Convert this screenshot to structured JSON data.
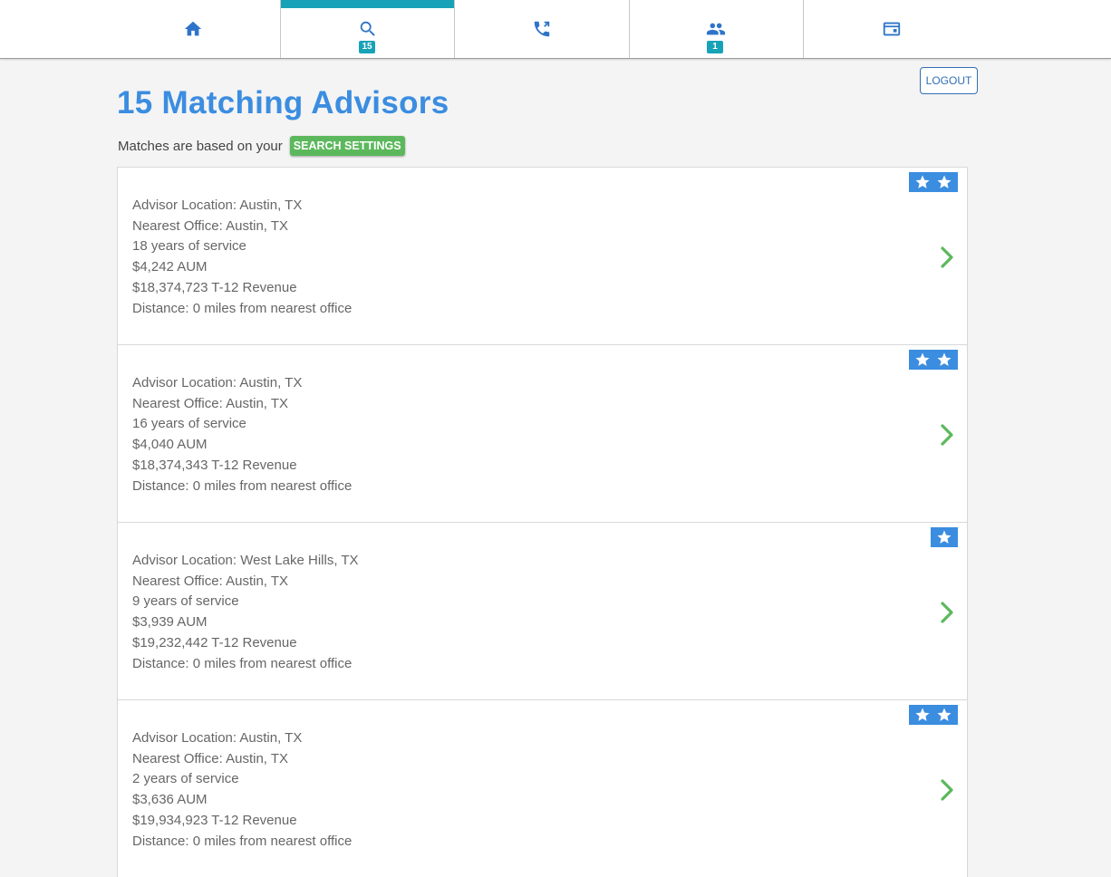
{
  "nav": {
    "tabs": [
      {
        "name": "home",
        "icon": "home-icon",
        "badge": null,
        "active": false
      },
      {
        "name": "search",
        "icon": "search-icon",
        "badge": "15",
        "active": true
      },
      {
        "name": "calls",
        "icon": "phone-icon",
        "badge": null,
        "active": false
      },
      {
        "name": "people",
        "icon": "people-icon",
        "badge": "1",
        "active": false
      },
      {
        "name": "profile",
        "icon": "card-icon",
        "badge": null,
        "active": false
      }
    ]
  },
  "header": {
    "logout_label": "LOGOUT",
    "title": "15 Matching Advisors",
    "subtitle": "Matches are based on your",
    "settings_label": "SEARCH SETTINGS"
  },
  "colors": {
    "brand_blue": "#3b8de0",
    "teal": "#17a2b8",
    "green": "#5cb85c"
  },
  "advisors": [
    {
      "location": "Advisor Location: Austin, TX",
      "office": "Nearest Office: Austin, TX",
      "service": "18 years of service",
      "aum": "$4,242 AUM",
      "revenue": "$18,374,723 T-12 Revenue",
      "distance": "Distance: 0 miles from nearest office",
      "stars": 2
    },
    {
      "location": "Advisor Location: Austin, TX",
      "office": "Nearest Office: Austin, TX",
      "service": "16 years of service",
      "aum": "$4,040 AUM",
      "revenue": "$18,374,343 T-12 Revenue",
      "distance": "Distance: 0 miles from nearest office",
      "stars": 2
    },
    {
      "location": "Advisor Location: West Lake Hills, TX",
      "office": "Nearest Office: Austin, TX",
      "service": "9 years of service",
      "aum": "$3,939 AUM",
      "revenue": "$19,232,442 T-12 Revenue",
      "distance": "Distance: 0 miles from nearest office",
      "stars": 1
    },
    {
      "location": "Advisor Location: Austin, TX",
      "office": "Nearest Office: Austin, TX",
      "service": "2 years of service",
      "aum": "$3,636 AUM",
      "revenue": "$19,934,923 T-12 Revenue",
      "distance": "Distance: 0 miles from nearest office",
      "stars": 2
    }
  ]
}
